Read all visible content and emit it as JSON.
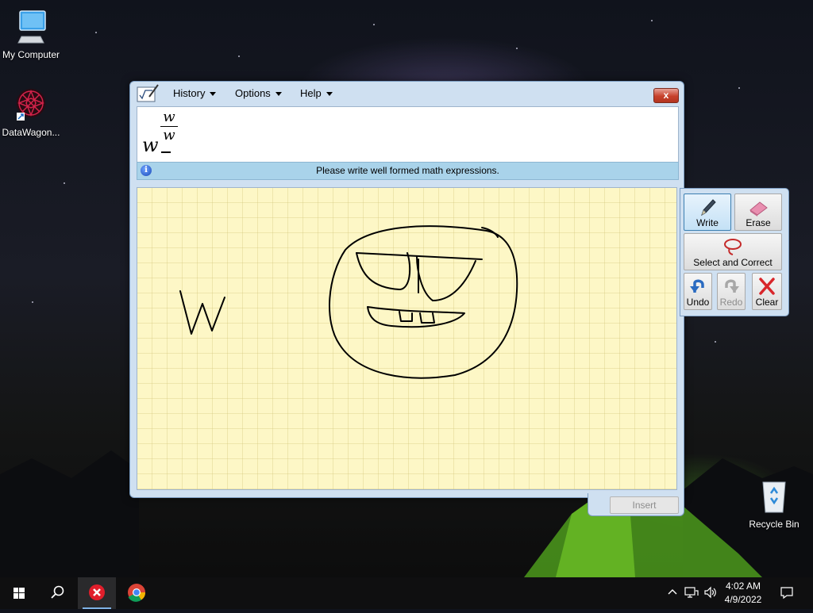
{
  "desktop": {
    "icons": [
      {
        "label": "My Computer"
      },
      {
        "label": "DataWagon..."
      },
      {
        "label": "Recycle Bin"
      }
    ]
  },
  "window": {
    "menus": [
      {
        "label": "History"
      },
      {
        "label": "Options"
      },
      {
        "label": "Help"
      }
    ],
    "close_label": "x",
    "preview_math": {
      "base": "w",
      "numerator": "w",
      "denominator": "w"
    },
    "status_message": "Please write well formed math expressions.",
    "insert_label": "Insert"
  },
  "tools": {
    "write": "Write",
    "erase": "Erase",
    "select_correct": "Select and Correct",
    "undo": "Undo",
    "redo": "Redo",
    "clear": "Clear"
  },
  "taskbar": {
    "time": "4:02 AM",
    "date": "4/9/2022"
  },
  "colors": {
    "pad_background": "#fdf7c6",
    "status_bar": "#a9d3ea",
    "close_button": "#c7412b"
  }
}
